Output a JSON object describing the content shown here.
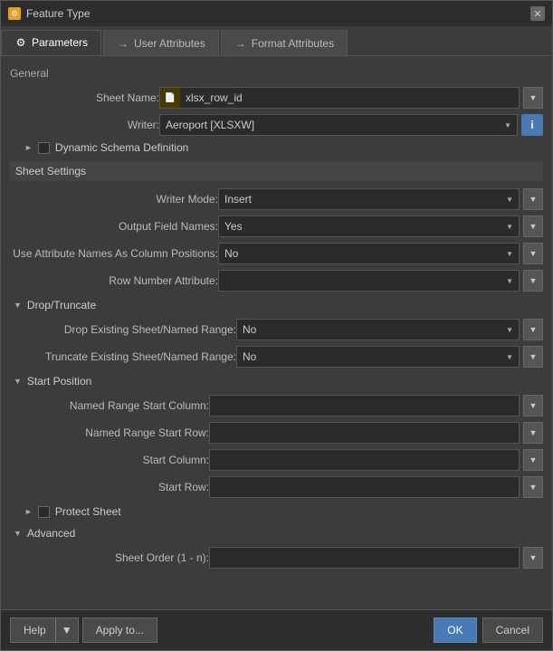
{
  "window": {
    "title": "Feature Type",
    "title_icon": "⚙"
  },
  "tabs": [
    {
      "id": "parameters",
      "label": "Parameters",
      "icon": "⚙",
      "active": true
    },
    {
      "id": "user-attributes",
      "label": "User Attributes",
      "icon": "→",
      "active": false
    },
    {
      "id": "format-attributes",
      "label": "Format Attributes",
      "icon": "→",
      "active": false
    }
  ],
  "general": {
    "label": "General",
    "sheet_name_label": "Sheet Name:",
    "sheet_name_value": "xlsx_row_id",
    "writer_label": "Writer:",
    "writer_value": "Aeroport [XLSXW]",
    "dynamic_schema_label": "Dynamic Schema Definition"
  },
  "sheet_settings": {
    "label": "Sheet Settings",
    "writer_mode_label": "Writer Mode:",
    "writer_mode_value": "Insert",
    "output_field_names_label": "Output Field Names:",
    "output_field_names_value": "Yes",
    "use_attribute_names_label": "Use Attribute Names As Column Positions:",
    "use_attribute_names_value": "No",
    "row_number_attribute_label": "Row Number Attribute:",
    "row_number_attribute_value": ""
  },
  "drop_truncate": {
    "label": "Drop/Truncate",
    "drop_existing_label": "Drop Existing Sheet/Named Range:",
    "drop_existing_value": "No",
    "truncate_existing_label": "Truncate Existing Sheet/Named Range:",
    "truncate_existing_value": "No"
  },
  "start_position": {
    "label": "Start Position",
    "named_range_start_col_label": "Named Range Start Column:",
    "named_range_start_col_value": "",
    "named_range_start_row_label": "Named Range Start Row:",
    "named_range_start_row_value": "",
    "start_column_label": "Start Column:",
    "start_column_value": "",
    "start_row_label": "Start Row:",
    "start_row_value": ""
  },
  "protect_sheet": {
    "label": "Protect Sheet"
  },
  "advanced": {
    "label": "Advanced",
    "sheet_order_label": "Sheet Order (1 - n):",
    "sheet_order_value": ""
  },
  "footer": {
    "help_label": "Help",
    "apply_label": "Apply to...",
    "ok_label": "OK",
    "cancel_label": "Cancel"
  },
  "icons": {
    "gear": "⚙",
    "arrow_right": "→",
    "dropdown_arrow": "▼",
    "collapse_down": "▼",
    "collapse_right": "►",
    "info": "i",
    "file": "📄",
    "close": "✕"
  }
}
